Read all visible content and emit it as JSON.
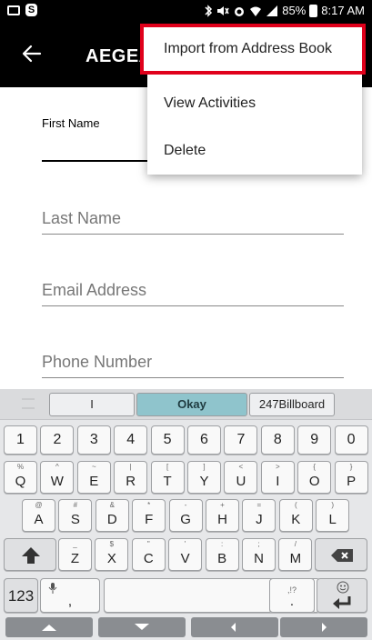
{
  "status_bar": {
    "battery": "85%",
    "time": "8:17 AM"
  },
  "app_bar": {
    "title": "AEGEAN"
  },
  "menu": {
    "items": [
      {
        "label": "Import from Address Book",
        "highlighted": true
      },
      {
        "label": "View Activities"
      },
      {
        "label": "Delete"
      }
    ]
  },
  "form": {
    "first_name_label": "First Name",
    "last_name_placeholder": "Last Name",
    "email_placeholder": "Email Address",
    "phone_placeholder": "Phone Number"
  },
  "keyboard": {
    "suggestions": [
      "I",
      "Okay",
      "247Billboard"
    ],
    "number_row": [
      "1",
      "2",
      "3",
      "4",
      "5",
      "6",
      "7",
      "8",
      "9",
      "0"
    ],
    "row1": [
      {
        "k": "Q",
        "a": "%"
      },
      {
        "k": "W",
        "a": "^"
      },
      {
        "k": "E",
        "a": "~"
      },
      {
        "k": "R",
        "a": "|"
      },
      {
        "k": "T",
        "a": "["
      },
      {
        "k": "Y",
        "a": "]"
      },
      {
        "k": "U",
        "a": "<"
      },
      {
        "k": "I",
        "a": ">"
      },
      {
        "k": "O",
        "a": "{"
      },
      {
        "k": "P",
        "a": "}"
      }
    ],
    "row2": [
      {
        "k": "A",
        "a": "@"
      },
      {
        "k": "S",
        "a": "#"
      },
      {
        "k": "D",
        "a": "&"
      },
      {
        "k": "F",
        "a": "*"
      },
      {
        "k": "G",
        "a": "-"
      },
      {
        "k": "H",
        "a": "+"
      },
      {
        "k": "J",
        "a": "="
      },
      {
        "k": "K",
        "a": "("
      },
      {
        "k": "L",
        "a": ")"
      }
    ],
    "row3": [
      {
        "k": "Z",
        "a": "_"
      },
      {
        "k": "X",
        "a": "$"
      },
      {
        "k": "C",
        "a": "\""
      },
      {
        "k": "V",
        "a": "'"
      },
      {
        "k": "B",
        "a": ":"
      },
      {
        "k": "N",
        "a": ";"
      },
      {
        "k": "M",
        "a": "/"
      }
    ],
    "numbers_key": "123",
    "comma_key": ",",
    "period_key": ".",
    "period_alt": ",!?"
  },
  "icons": {
    "back": "back-arrow-icon",
    "mail": "mail-icon",
    "skype": "skype-icon",
    "shift": "shift-icon",
    "backspace": "backspace-icon",
    "enter": "enter-icon",
    "mic": "mic-icon",
    "emoji": "emoji-icon"
  },
  "colors": {
    "app_bar_bg": "#000000",
    "highlight_border": "#e0001b",
    "suggestion_selected": "#8fc4cc"
  }
}
